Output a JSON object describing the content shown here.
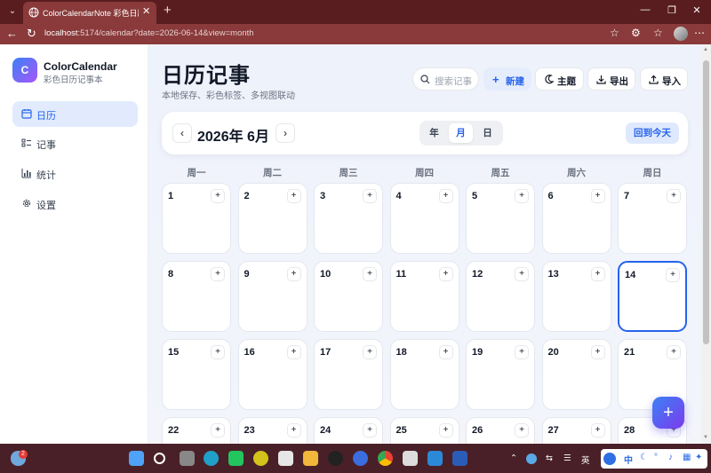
{
  "browser": {
    "tab_title": "ColorCalendarNote 彩色日历记事",
    "tab_close": "✕",
    "new_tab": "+",
    "url_host": "localhost",
    "url_rest": ":5174/calendar?date=2026-06-14&view=month",
    "icons": [
      "tab-menu-icon",
      "globe-icon",
      "back-icon",
      "reload-icon",
      "star-icon",
      "extensions-icon",
      "favorites-icon",
      "more-icon",
      "minimize-icon",
      "maximize-icon",
      "close-icon"
    ]
  },
  "sidebar": {
    "logo_letter": "C",
    "brand_name": "ColorCalendar",
    "brand_sub": "彩色日历记事本",
    "items": [
      {
        "label": "日历",
        "icon": "calendar-icon",
        "active": true
      },
      {
        "label": "记事",
        "icon": "notes-icon",
        "active": false
      },
      {
        "label": "统计",
        "icon": "chart-icon",
        "active": false
      },
      {
        "label": "设置",
        "icon": "gear-icon",
        "active": false
      }
    ]
  },
  "header": {
    "title": "日历记事",
    "subtitle": "本地保存、彩色标签、多视图联动",
    "search_placeholder": "搜索记事",
    "new_label": "新建",
    "theme_label": "主题",
    "export_label": "导出",
    "import_label": "导入"
  },
  "toolbar": {
    "prev": "‹",
    "next": "›",
    "current_month": "2026年 6月",
    "views": [
      {
        "label": "年",
        "active": false
      },
      {
        "label": "月",
        "active": true
      },
      {
        "label": "日",
        "active": false
      }
    ],
    "today_label": "回到今天"
  },
  "calendar": {
    "weekdays": [
      "周一",
      "周二",
      "周三",
      "周四",
      "周五",
      "周六",
      "周日"
    ],
    "selected_day": "14",
    "add_label": "+",
    "days": [
      "1",
      "2",
      "3",
      "4",
      "5",
      "6",
      "7",
      "8",
      "9",
      "10",
      "11",
      "12",
      "13",
      "14",
      "15",
      "16",
      "17",
      "18",
      "19",
      "20",
      "21",
      "22",
      "23",
      "24",
      "25",
      "26",
      "27",
      "28"
    ]
  },
  "fab_label": "+",
  "taskbar": {
    "weather_badge": "2",
    "lang_cn": "中",
    "lang_en": "英"
  },
  "colors": {
    "accent": "#2563eb",
    "brand_gradient_start": "#3b82f6",
    "brand_gradient_end": "#a855f7",
    "browser_frame": "#8a3a3a"
  }
}
